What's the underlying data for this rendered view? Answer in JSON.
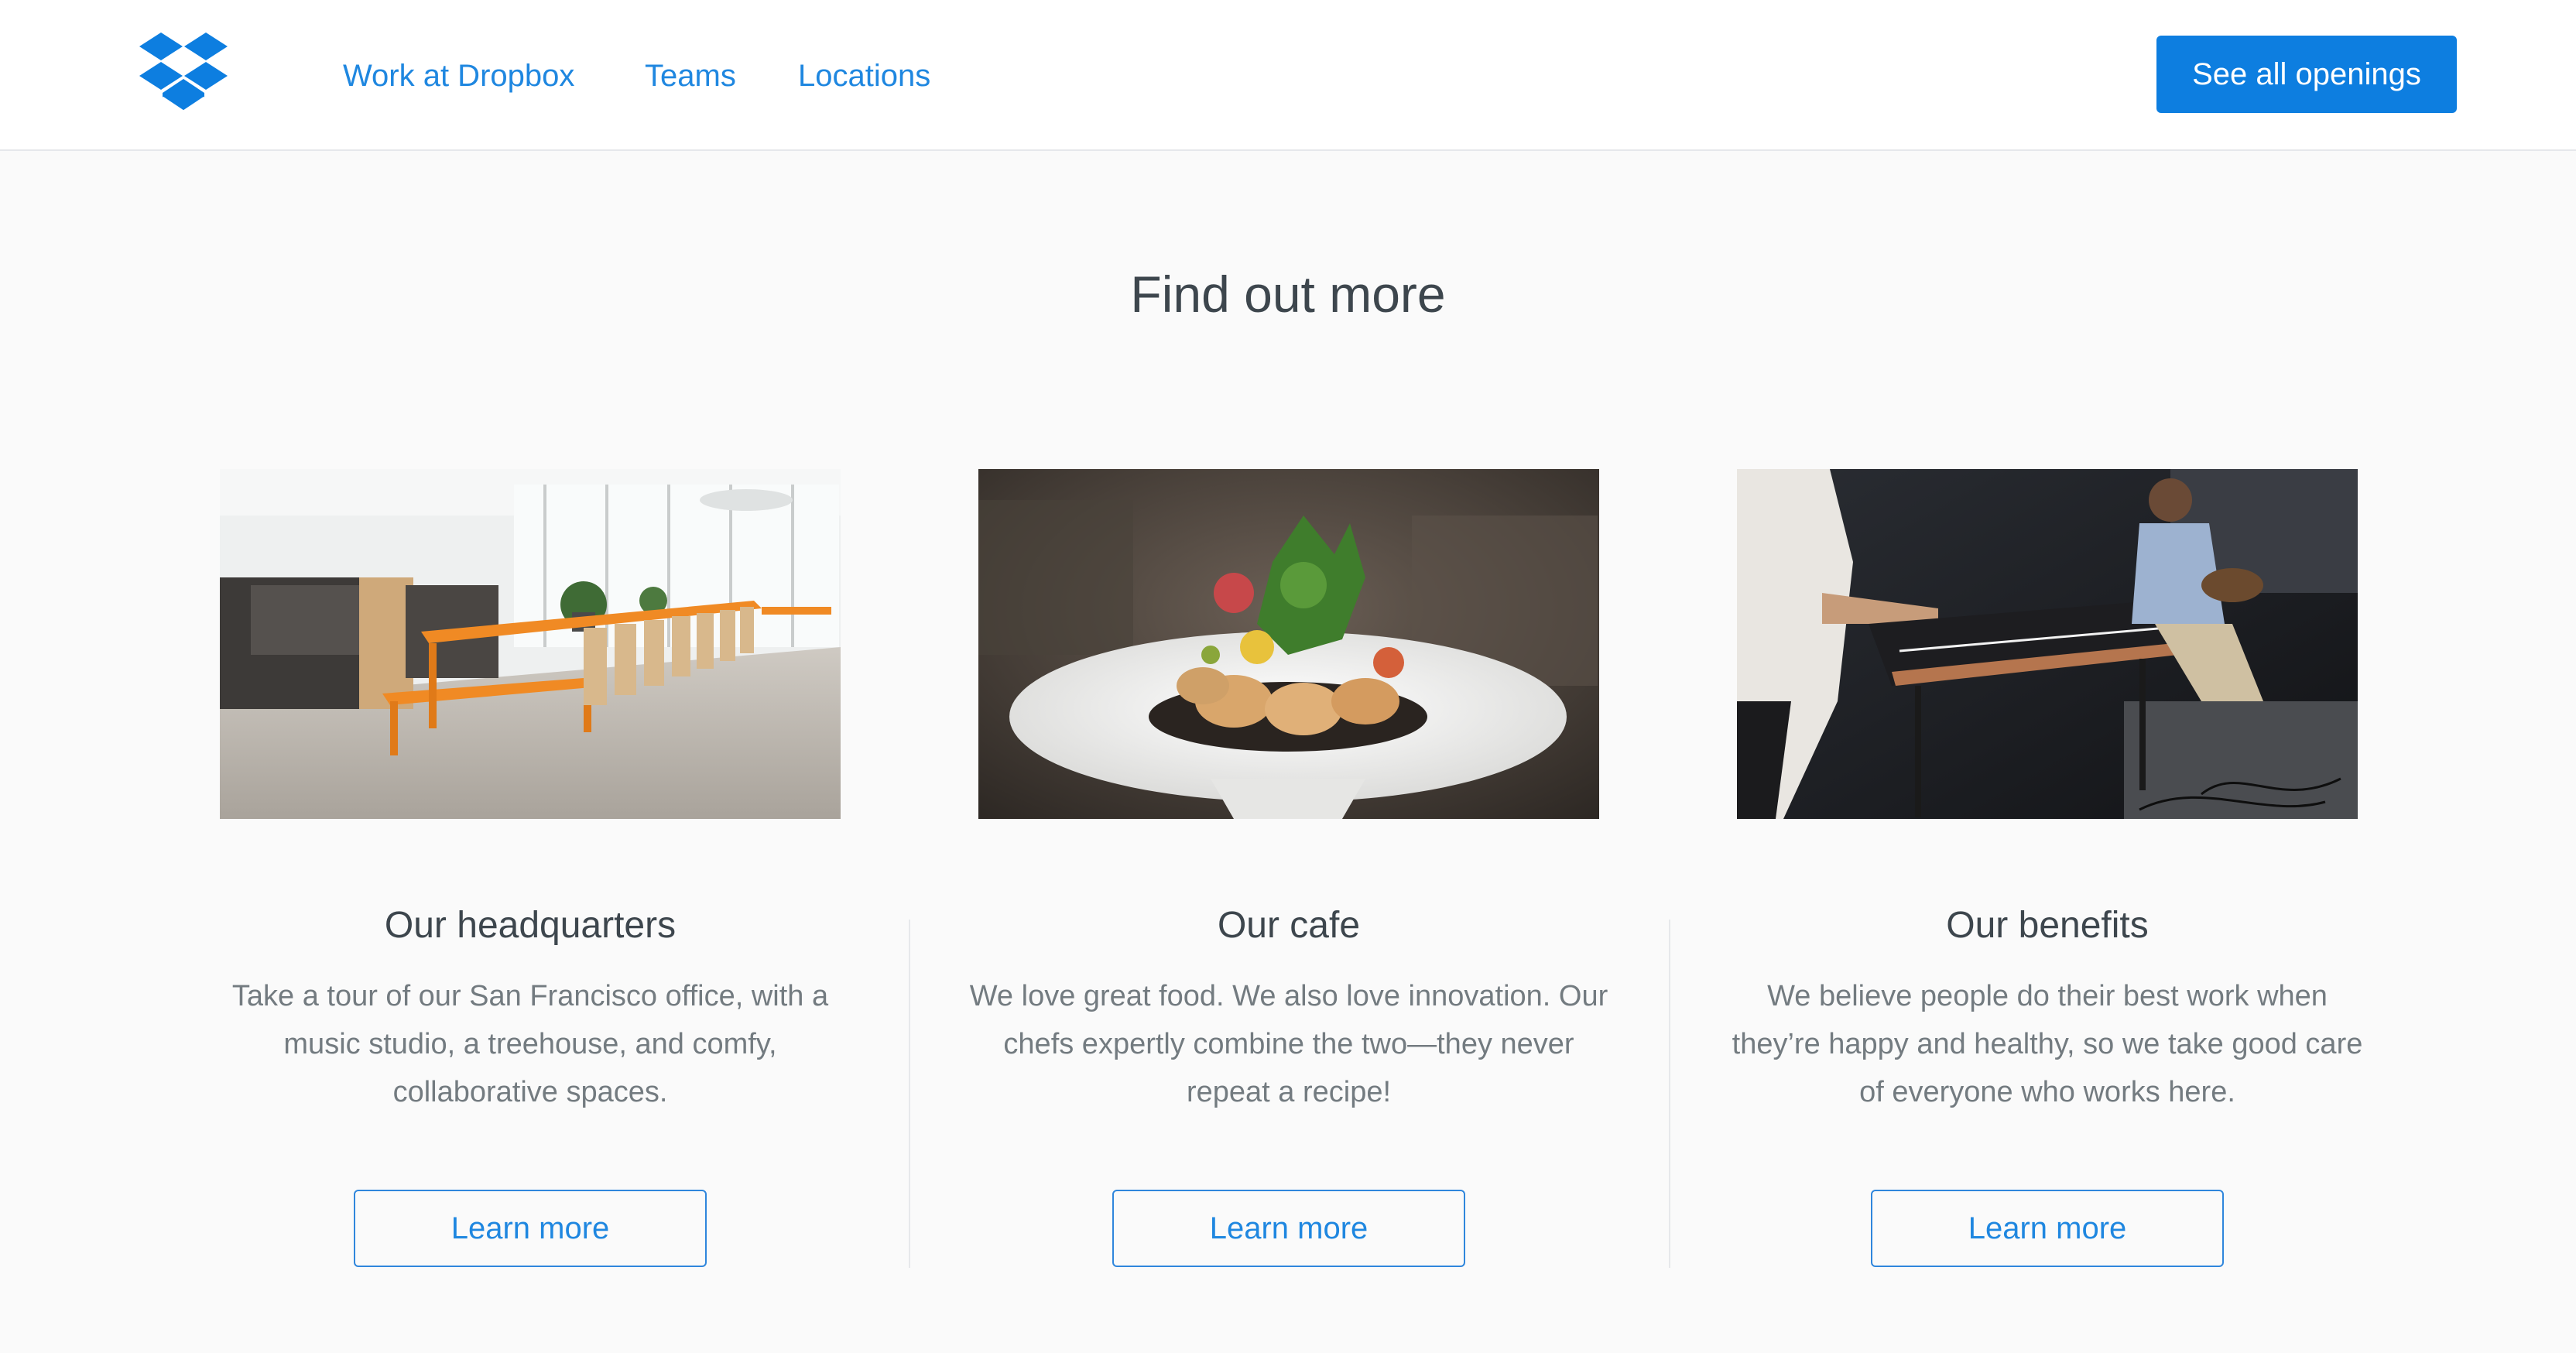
{
  "header": {
    "logo_icon": "dropbox-logo-icon",
    "nav": [
      {
        "label": "Work at Dropbox"
      },
      {
        "label": "Teams"
      },
      {
        "label": "Locations"
      }
    ],
    "cta_label": "See all openings"
  },
  "main": {
    "title": "Find out more",
    "cards": [
      {
        "image": "office-photo",
        "title": "Our headquarters",
        "text": "Take a tour of our San Francisco office, with a music studio, a treehouse, and comfy, collaborative spaces.",
        "button_label": "Learn more"
      },
      {
        "image": "food-photo",
        "title": "Our cafe",
        "text": "We love great food. We also love innovation. Our chefs expertly combine the two—they never repeat a recipe!",
        "button_label": "Learn more"
      },
      {
        "image": "music-photo",
        "title": "Our benefits",
        "text": "We believe people do their best work when they’re happy and healthy, so we take good care of everyone who works here.",
        "button_label": "Learn more"
      }
    ]
  },
  "colors": {
    "accent": "#0d7ee0",
    "link": "#1f87e0",
    "background": "#fafafa",
    "heading": "#3d464d",
    "body_text": "#737b80"
  }
}
